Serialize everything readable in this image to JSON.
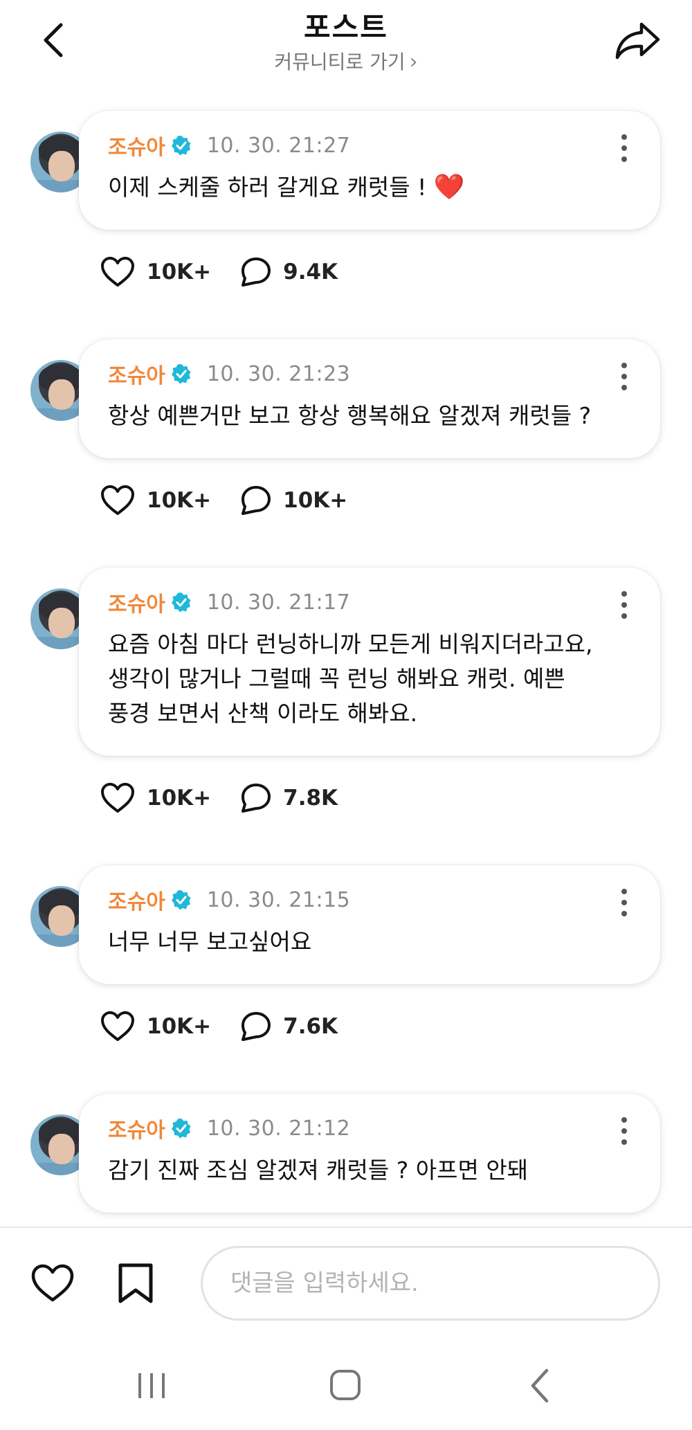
{
  "header": {
    "title": "포스트",
    "community_link": "커뮤니티로 가기",
    "community_chevron": "›",
    "icons": {
      "back": "chevron-left-icon",
      "share": "share-arrow-icon"
    }
  },
  "colors": {
    "name": "#f0883a",
    "verified": "#20b8d8",
    "time": "#8a8a8a",
    "heart_emoji": "#ff3b6b"
  },
  "posts": [
    {
      "author": "조슈아",
      "time": "10. 30. 21:27",
      "text": "이제 스케줄 하러 갈게요 캐럿들 ! ",
      "emoji": "❤️",
      "likes": "10K+",
      "comments": "9.4K"
    },
    {
      "author": "조슈아",
      "time": "10. 30. 21:23",
      "text": "항상 예쁜거만 보고 항상 행복해요 알겠져 캐럿들 ?",
      "likes": "10K+",
      "comments": "10K+"
    },
    {
      "author": "조슈아",
      "time": "10. 30. 21:17",
      "text": "요즘 아침 마다 런닝하니까 모든게 비워지더라고요,\n생각이 많거나 그럴때 꼭 런닝 해봐요 캐럿. 예쁜\n풍경 보면서 산책 이라도 해봐요.",
      "likes": "10K+",
      "comments": "7.8K"
    },
    {
      "author": "조슈아",
      "time": "10. 30. 21:15",
      "text": "너무 너무 보고싶어요",
      "likes": "10K+",
      "comments": "7.6K"
    },
    {
      "author": "조슈아",
      "time": "10. 30. 21:12",
      "text": "감기 진짜 조심  알겠져 캐럿들 ? 아프면 안돼"
    }
  ],
  "bottom_bar": {
    "comment_placeholder": "댓글을 입력하세요.",
    "icons": {
      "like": "heart-outline-icon",
      "bookmark": "bookmark-outline-icon"
    }
  },
  "system_nav": {
    "icons": {
      "recent": "recent-apps-icon",
      "home": "home-icon",
      "back": "back-icon"
    }
  }
}
